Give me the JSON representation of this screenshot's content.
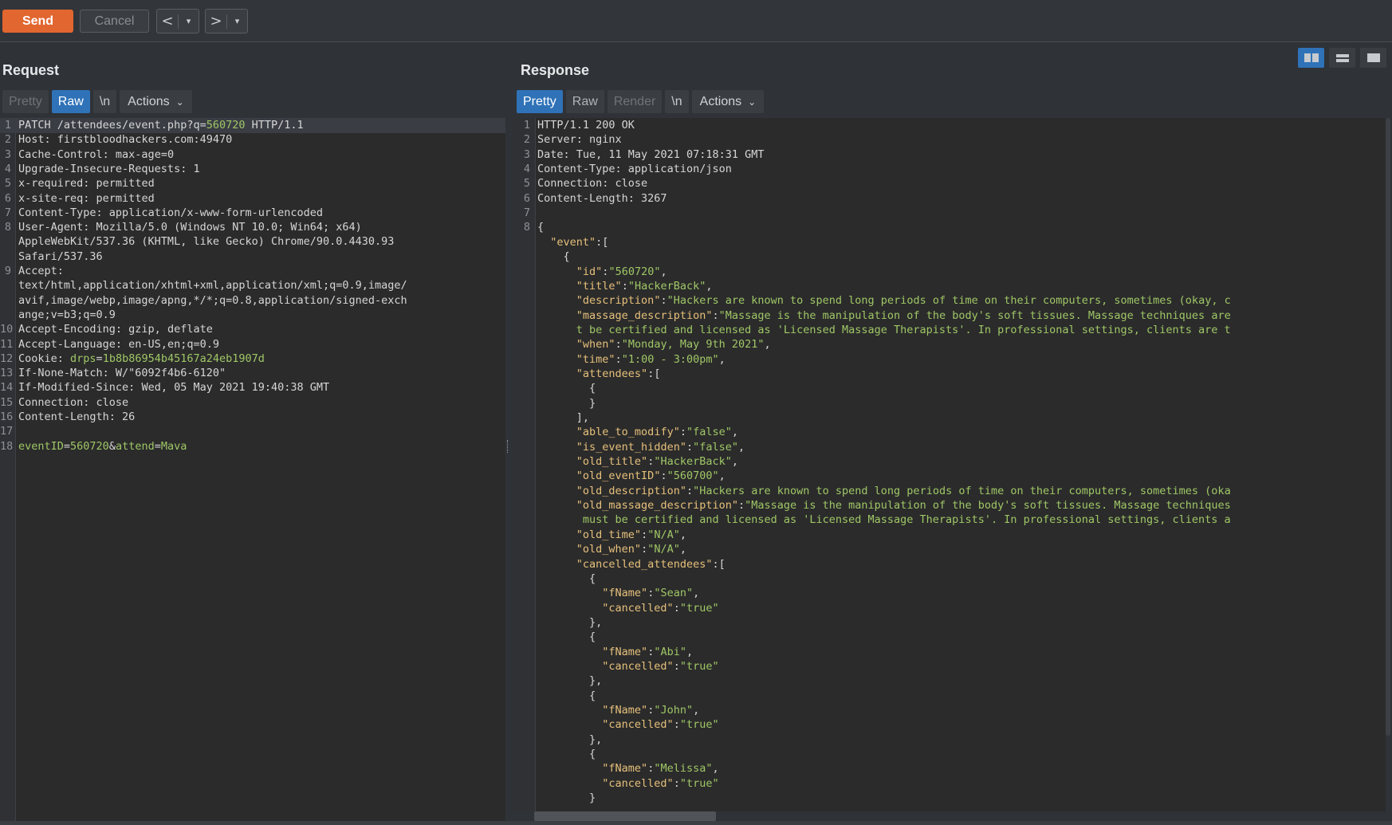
{
  "toolbar": {
    "send_label": "Send",
    "cancel_label": "Cancel",
    "back_glyph": "<",
    "forward_glyph": ">",
    "dropdown_glyph": "▾"
  },
  "request": {
    "title": "Request",
    "tabs": {
      "pretty": "Pretty",
      "raw": "Raw",
      "newline": "\\n",
      "actions": "Actions"
    },
    "lines": [
      {
        "n": "1",
        "segs": [
          [
            "k",
            "PATCH /attendees/event.php?q="
          ],
          [
            "g",
            "560720"
          ],
          [
            "k",
            " HTTP/1.1"
          ]
        ]
      },
      {
        "n": "2",
        "segs": [
          [
            "k",
            "Host: "
          ],
          [
            "v",
            "firstbloodhackers.com:49470"
          ]
        ]
      },
      {
        "n": "3",
        "segs": [
          [
            "k",
            "Cache-Control: "
          ],
          [
            "v",
            "max-age=0"
          ]
        ]
      },
      {
        "n": "4",
        "segs": [
          [
            "k",
            "Upgrade-Insecure-Requests: "
          ],
          [
            "v",
            "1"
          ]
        ]
      },
      {
        "n": "5",
        "segs": [
          [
            "k",
            "x-required: "
          ],
          [
            "v",
            "permitted"
          ]
        ]
      },
      {
        "n": "6",
        "segs": [
          [
            "k",
            "x-site-req: "
          ],
          [
            "v",
            "permitted"
          ]
        ]
      },
      {
        "n": "7",
        "segs": [
          [
            "k",
            "Content-Type: "
          ],
          [
            "v",
            "application/x-www-form-urlencoded"
          ]
        ]
      },
      {
        "n": "8",
        "segs": [
          [
            "k",
            "User-Agent: "
          ],
          [
            "v",
            "Mozilla/5.0 (Windows NT 10.0; Win64; x64)"
          ]
        ]
      },
      {
        "n": "",
        "segs": [
          [
            "v",
            "AppleWebKit/537.36 (KHTML, like Gecko) Chrome/90.0.4430.93"
          ]
        ]
      },
      {
        "n": "",
        "segs": [
          [
            "v",
            "Safari/537.36"
          ]
        ]
      },
      {
        "n": "9",
        "segs": [
          [
            "k",
            "Accept: "
          ]
        ]
      },
      {
        "n": "",
        "segs": [
          [
            "v",
            "text/html,application/xhtml+xml,application/xml;q=0.9,image/"
          ]
        ]
      },
      {
        "n": "",
        "segs": [
          [
            "v",
            "avif,image/webp,image/apng,*/*;q=0.8,application/signed-exch"
          ]
        ]
      },
      {
        "n": "",
        "segs": [
          [
            "v",
            "ange;v=b3;q=0.9"
          ]
        ]
      },
      {
        "n": "10",
        "segs": [
          [
            "k",
            "Accept-Encoding: "
          ],
          [
            "v",
            "gzip, deflate"
          ]
        ]
      },
      {
        "n": "11",
        "segs": [
          [
            "k",
            "Accept-Language: "
          ],
          [
            "v",
            "en-US,en;q=0.9"
          ]
        ]
      },
      {
        "n": "12",
        "segs": [
          [
            "k",
            "Cookie: "
          ],
          [
            "g",
            "drps"
          ],
          [
            "k",
            "="
          ],
          [
            "g",
            "1b8b86954b45167a24eb1907d"
          ]
        ]
      },
      {
        "n": "13",
        "segs": [
          [
            "k",
            "If-None-Match: "
          ],
          [
            "v",
            "W/\"6092f4b6-6120\""
          ]
        ]
      },
      {
        "n": "14",
        "segs": [
          [
            "k",
            "If-Modified-Since: "
          ],
          [
            "v",
            "Wed, 05 May 2021 19:40:38 GMT"
          ]
        ]
      },
      {
        "n": "15",
        "segs": [
          [
            "k",
            "Connection: "
          ],
          [
            "v",
            "close"
          ]
        ]
      },
      {
        "n": "16",
        "segs": [
          [
            "k",
            "Content-Length: "
          ],
          [
            "v",
            "26"
          ]
        ]
      },
      {
        "n": "17",
        "segs": []
      },
      {
        "n": "18",
        "segs": [
          [
            "g",
            "eventID"
          ],
          [
            "k",
            "="
          ],
          [
            "g",
            "560720"
          ],
          [
            "k",
            "&"
          ],
          [
            "g",
            "attend"
          ],
          [
            "k",
            "="
          ],
          [
            "g",
            "Mava"
          ]
        ]
      }
    ]
  },
  "response": {
    "title": "Response",
    "tabs": {
      "pretty": "Pretty",
      "raw": "Raw",
      "render": "Render",
      "newline": "\\n",
      "actions": "Actions"
    },
    "lines": [
      {
        "n": "1",
        "segs": [
          [
            "k",
            "HTTP/1.1 200 OK"
          ]
        ]
      },
      {
        "n": "2",
        "segs": [
          [
            "k",
            "Server: "
          ],
          [
            "v",
            "nginx"
          ]
        ]
      },
      {
        "n": "3",
        "segs": [
          [
            "k",
            "Date: "
          ],
          [
            "v",
            "Tue, 11 May 2021 07:18:31 GMT"
          ]
        ]
      },
      {
        "n": "4",
        "segs": [
          [
            "k",
            "Content-Type: "
          ],
          [
            "v",
            "application/json"
          ]
        ]
      },
      {
        "n": "5",
        "segs": [
          [
            "k",
            "Connection: "
          ],
          [
            "v",
            "close"
          ]
        ]
      },
      {
        "n": "6",
        "segs": [
          [
            "k",
            "Content-Length: "
          ],
          [
            "v",
            "3267"
          ]
        ]
      },
      {
        "n": "7",
        "segs": []
      },
      {
        "n": "8",
        "segs": [
          [
            "k",
            "{"
          ]
        ]
      },
      {
        "n": "",
        "segs": [
          [
            "k",
            "  "
          ],
          [
            "s",
            "\"event\""
          ],
          [
            "k",
            ":["
          ]
        ]
      },
      {
        "n": "",
        "segs": [
          [
            "k",
            "    {"
          ]
        ]
      },
      {
        "n": "",
        "segs": [
          [
            "k",
            "      "
          ],
          [
            "s",
            "\"id\""
          ],
          [
            "k",
            ":"
          ],
          [
            "str",
            "\"560720\""
          ],
          [
            "k",
            ","
          ]
        ]
      },
      {
        "n": "",
        "segs": [
          [
            "k",
            "      "
          ],
          [
            "s",
            "\"title\""
          ],
          [
            "k",
            ":"
          ],
          [
            "str",
            "\"HackerBack\""
          ],
          [
            "k",
            ","
          ]
        ]
      },
      {
        "n": "",
        "segs": [
          [
            "k",
            "      "
          ],
          [
            "s",
            "\"description\""
          ],
          [
            "k",
            ":"
          ],
          [
            "str",
            "\"Hackers are known to spend long periods of time on their computers, sometimes (okay, c"
          ]
        ]
      },
      {
        "n": "",
        "segs": [
          [
            "k",
            "      "
          ],
          [
            "s",
            "\"massage_description\""
          ],
          [
            "k",
            ":"
          ],
          [
            "str",
            "\"Massage is the manipulation of the body's soft tissues. Massage techniques are"
          ]
        ]
      },
      {
        "n": "",
        "segs": [
          [
            "k",
            "      "
          ],
          [
            "str",
            "t be certified and licensed as 'Licensed Massage Therapists'. In professional settings, clients are t"
          ]
        ]
      },
      {
        "n": "",
        "segs": [
          [
            "k",
            "      "
          ],
          [
            "s",
            "\"when\""
          ],
          [
            "k",
            ":"
          ],
          [
            "str",
            "\"Monday, May 9th 2021\""
          ],
          [
            "k",
            ","
          ]
        ]
      },
      {
        "n": "",
        "segs": [
          [
            "k",
            "      "
          ],
          [
            "s",
            "\"time\""
          ],
          [
            "k",
            ":"
          ],
          [
            "str",
            "\"1:00 - 3:00pm\""
          ],
          [
            "k",
            ","
          ]
        ]
      },
      {
        "n": "",
        "segs": [
          [
            "k",
            "      "
          ],
          [
            "s",
            "\"attendees\""
          ],
          [
            "k",
            ":["
          ]
        ]
      },
      {
        "n": "",
        "segs": [
          [
            "k",
            "        {"
          ]
        ]
      },
      {
        "n": "",
        "segs": [
          [
            "k",
            "        }"
          ]
        ]
      },
      {
        "n": "",
        "segs": [
          [
            "k",
            "      ],"
          ]
        ]
      },
      {
        "n": "",
        "segs": [
          [
            "k",
            "      "
          ],
          [
            "s",
            "\"able_to_modify\""
          ],
          [
            "k",
            ":"
          ],
          [
            "str",
            "\"false\""
          ],
          [
            "k",
            ","
          ]
        ]
      },
      {
        "n": "",
        "segs": [
          [
            "k",
            "      "
          ],
          [
            "s",
            "\"is_event_hidden\""
          ],
          [
            "k",
            ":"
          ],
          [
            "str",
            "\"false\""
          ],
          [
            "k",
            ","
          ]
        ]
      },
      {
        "n": "",
        "segs": [
          [
            "k",
            "      "
          ],
          [
            "s",
            "\"old_title\""
          ],
          [
            "k",
            ":"
          ],
          [
            "str",
            "\"HackerBack\""
          ],
          [
            "k",
            ","
          ]
        ]
      },
      {
        "n": "",
        "segs": [
          [
            "k",
            "      "
          ],
          [
            "s",
            "\"old_eventID\""
          ],
          [
            "k",
            ":"
          ],
          [
            "str",
            "\"560700\""
          ],
          [
            "k",
            ","
          ]
        ]
      },
      {
        "n": "",
        "segs": [
          [
            "k",
            "      "
          ],
          [
            "s",
            "\"old_description\""
          ],
          [
            "k",
            ":"
          ],
          [
            "str",
            "\"Hackers are known to spend long periods of time on their computers, sometimes (oka"
          ]
        ]
      },
      {
        "n": "",
        "segs": [
          [
            "k",
            "      "
          ],
          [
            "s",
            "\"old_massage_description\""
          ],
          [
            "k",
            ":"
          ],
          [
            "str",
            "\"Massage is the manipulation of the body's soft tissues. Massage techniques"
          ]
        ]
      },
      {
        "n": "",
        "segs": [
          [
            "k",
            "       "
          ],
          [
            "str",
            "must be certified and licensed as 'Licensed Massage Therapists'. In professional settings, clients a"
          ]
        ]
      },
      {
        "n": "",
        "segs": [
          [
            "k",
            "      "
          ],
          [
            "s",
            "\"old_time\""
          ],
          [
            "k",
            ":"
          ],
          [
            "str",
            "\"N/A\""
          ],
          [
            "k",
            ","
          ]
        ]
      },
      {
        "n": "",
        "segs": [
          [
            "k",
            "      "
          ],
          [
            "s",
            "\"old_when\""
          ],
          [
            "k",
            ":"
          ],
          [
            "str",
            "\"N/A\""
          ],
          [
            "k",
            ","
          ]
        ]
      },
      {
        "n": "",
        "segs": [
          [
            "k",
            "      "
          ],
          [
            "s",
            "\"cancelled_attendees\""
          ],
          [
            "k",
            ":["
          ]
        ]
      },
      {
        "n": "",
        "segs": [
          [
            "k",
            "        {"
          ]
        ]
      },
      {
        "n": "",
        "segs": [
          [
            "k",
            "          "
          ],
          [
            "s",
            "\"fName\""
          ],
          [
            "k",
            ":"
          ],
          [
            "str",
            "\"Sean\""
          ],
          [
            "k",
            ","
          ]
        ]
      },
      {
        "n": "",
        "segs": [
          [
            "k",
            "          "
          ],
          [
            "s",
            "\"cancelled\""
          ],
          [
            "k",
            ":"
          ],
          [
            "str",
            "\"true\""
          ]
        ]
      },
      {
        "n": "",
        "segs": [
          [
            "k",
            "        },"
          ]
        ]
      },
      {
        "n": "",
        "segs": [
          [
            "k",
            "        {"
          ]
        ]
      },
      {
        "n": "",
        "segs": [
          [
            "k",
            "          "
          ],
          [
            "s",
            "\"fName\""
          ],
          [
            "k",
            ":"
          ],
          [
            "str",
            "\"Abi\""
          ],
          [
            "k",
            ","
          ]
        ]
      },
      {
        "n": "",
        "segs": [
          [
            "k",
            "          "
          ],
          [
            "s",
            "\"cancelled\""
          ],
          [
            "k",
            ":"
          ],
          [
            "str",
            "\"true\""
          ]
        ]
      },
      {
        "n": "",
        "segs": [
          [
            "k",
            "        },"
          ]
        ]
      },
      {
        "n": "",
        "segs": [
          [
            "k",
            "        {"
          ]
        ]
      },
      {
        "n": "",
        "segs": [
          [
            "k",
            "          "
          ],
          [
            "s",
            "\"fName\""
          ],
          [
            "k",
            ":"
          ],
          [
            "str",
            "\"John\""
          ],
          [
            "k",
            ","
          ]
        ]
      },
      {
        "n": "",
        "segs": [
          [
            "k",
            "          "
          ],
          [
            "s",
            "\"cancelled\""
          ],
          [
            "k",
            ":"
          ],
          [
            "str",
            "\"true\""
          ]
        ]
      },
      {
        "n": "",
        "segs": [
          [
            "k",
            "        },"
          ]
        ]
      },
      {
        "n": "",
        "segs": [
          [
            "k",
            "        {"
          ]
        ]
      },
      {
        "n": "",
        "segs": [
          [
            "k",
            "          "
          ],
          [
            "s",
            "\"fName\""
          ],
          [
            "k",
            ":"
          ],
          [
            "str",
            "\"Melissa\""
          ],
          [
            "k",
            ","
          ]
        ]
      },
      {
        "n": "",
        "segs": [
          [
            "k",
            "          "
          ],
          [
            "s",
            "\"cancelled\""
          ],
          [
            "k",
            ":"
          ],
          [
            "str",
            "\"true\""
          ]
        ]
      },
      {
        "n": "",
        "segs": [
          [
            "k",
            "        }"
          ]
        ]
      }
    ]
  },
  "colors": {
    "send": "#e2662f",
    "active_tab": "#2f72b8",
    "json_key": "#e6c07b",
    "json_value": "#9fc766"
  }
}
